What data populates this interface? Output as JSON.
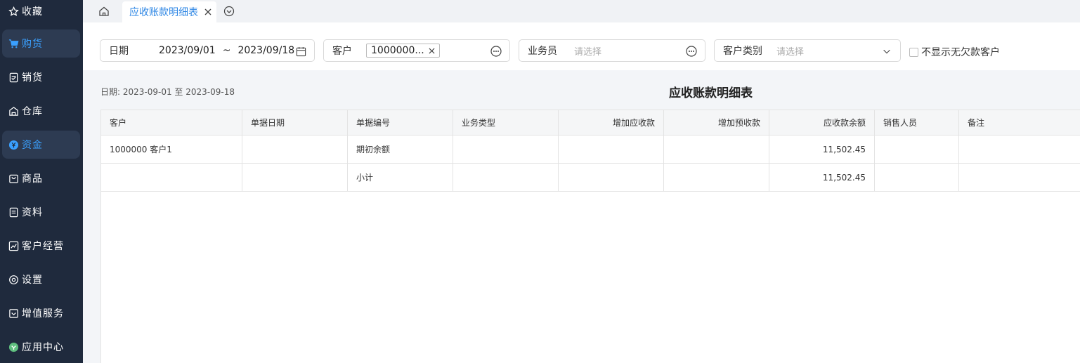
{
  "sidebar": {
    "items": [
      {
        "label": "收藏",
        "icon": "star-icon"
      },
      {
        "label": "购货",
        "icon": "cart-icon",
        "active": true
      },
      {
        "label": "销货",
        "icon": "receipt-icon"
      },
      {
        "label": "仓库",
        "icon": "warehouse-icon"
      },
      {
        "label": "资金",
        "icon": "yen-coin-icon",
        "active": true
      },
      {
        "label": "商品",
        "icon": "bag-icon"
      },
      {
        "label": "资料",
        "icon": "document-icon"
      },
      {
        "label": "客户经营",
        "icon": "chart-icon"
      },
      {
        "label": "设置",
        "icon": "gear-icon"
      },
      {
        "label": "增值服务",
        "icon": "shop-icon"
      },
      {
        "label": "应用中心",
        "icon": "app-icon"
      }
    ]
  },
  "tabs": {
    "active_label": "应收账款明细表"
  },
  "filters": {
    "date_label": "日期",
    "date_start": "2023/09/01",
    "date_sep": "~",
    "date_end": "2023/09/18",
    "customer_label": "客户",
    "customer_tag": "1000000...",
    "salesperson_label": "业务员",
    "salesperson_placeholder": "请选择",
    "customer_type_label": "客户类别",
    "customer_type_placeholder": "请选择",
    "hide_no_debt_label": "不显示无欠款客户"
  },
  "report": {
    "date_note": "日期: 2023-09-01 至 2023-09-18",
    "title": "应收账款明细表",
    "columns": [
      "客户",
      "单据日期",
      "单据编号",
      "业务类型",
      "增加应收款",
      "增加预收款",
      "应收款余额",
      "销售人员",
      "备注"
    ],
    "rows": [
      [
        "1000000 客户1",
        "",
        "期初余额",
        "",
        "",
        "",
        "11,502.45",
        "",
        ""
      ],
      [
        "",
        "",
        "小计",
        "",
        "",
        "",
        "11,502.45",
        "",
        ""
      ]
    ]
  },
  "colors": {
    "sidebar_bg": "#1f2a3d",
    "accent": "#2b85e4",
    "active_nav": "#3aa0ff"
  }
}
